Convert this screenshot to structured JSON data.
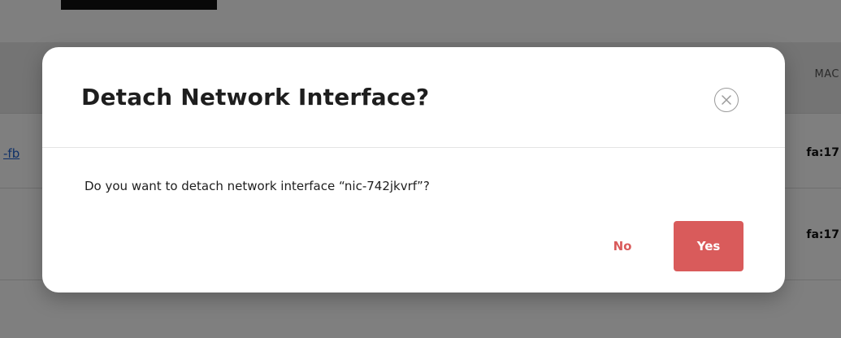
{
  "background": {
    "table_header": {
      "mac_column_label": "MAC"
    },
    "rows": [
      {
        "link_text": "-fb",
        "mac_text": "fa:17"
      },
      {
        "link_text": "",
        "mac_text": "fa:17"
      }
    ]
  },
  "modal": {
    "title": "Detach Network Interface?",
    "message": "Do you want to detach network interface “nic-742jkvrf”?",
    "close_icon": "close-circle-icon",
    "no_label": "No",
    "yes_label": "Yes"
  },
  "colors": {
    "accent": "#d95b5b",
    "overlay": "rgba(0,0,0,0.5)"
  }
}
